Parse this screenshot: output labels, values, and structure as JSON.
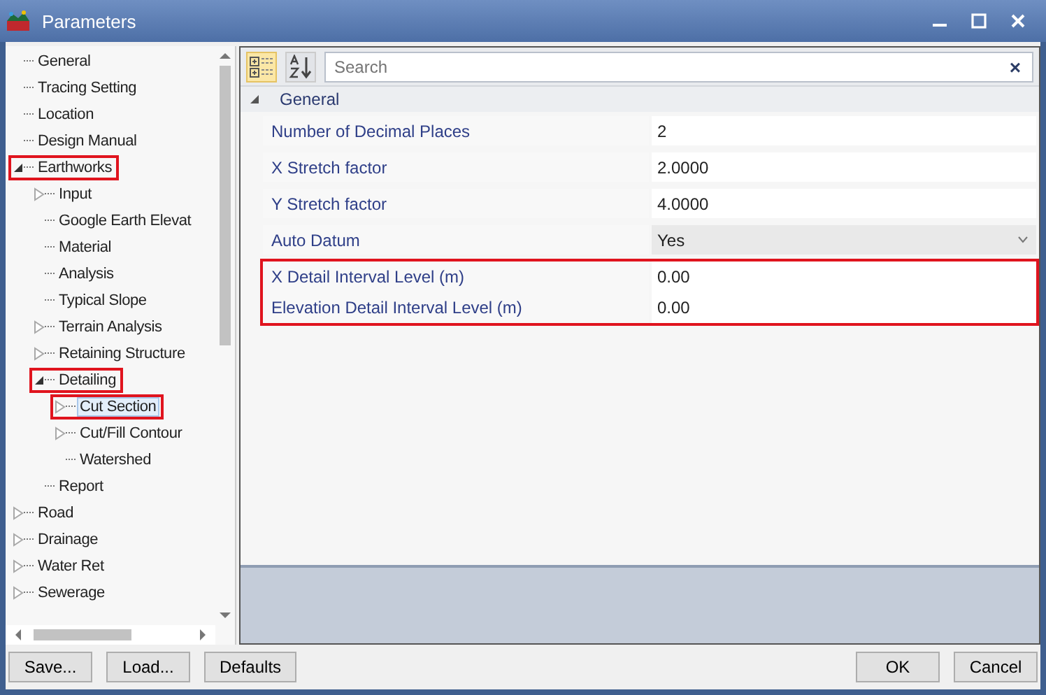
{
  "window": {
    "title": "Parameters"
  },
  "tree": [
    {
      "label": "General",
      "kind": "leaf",
      "selected": false,
      "highlighted": false
    },
    {
      "label": "Tracing Setting",
      "kind": "leaf",
      "selected": false,
      "highlighted": false
    },
    {
      "label": "Location",
      "kind": "leaf",
      "selected": false,
      "highlighted": false
    },
    {
      "label": "Design Manual",
      "kind": "leaf",
      "selected": false,
      "highlighted": false
    },
    {
      "label": "Earthworks",
      "kind": "expanded",
      "selected": false,
      "highlighted": true,
      "children": [
        {
          "label": "Input",
          "kind": "collapsed",
          "selected": false,
          "highlighted": false
        },
        {
          "label": "Google Earth Elevat",
          "kind": "leaf",
          "selected": false,
          "highlighted": false
        },
        {
          "label": "Material",
          "kind": "leaf",
          "selected": false,
          "highlighted": false
        },
        {
          "label": "Analysis",
          "kind": "leaf",
          "selected": false,
          "highlighted": false
        },
        {
          "label": "Typical Slope",
          "kind": "leaf",
          "selected": false,
          "highlighted": false
        },
        {
          "label": "Terrain Analysis",
          "kind": "collapsed",
          "selected": false,
          "highlighted": false
        },
        {
          "label": "Retaining Structure",
          "kind": "collapsed",
          "selected": false,
          "highlighted": false
        },
        {
          "label": "Detailing",
          "kind": "expanded",
          "selected": false,
          "highlighted": true,
          "children": [
            {
              "label": "Cut Section",
              "kind": "collapsed",
              "selected": true,
              "highlighted": true
            },
            {
              "label": "Cut/Fill Contour",
              "kind": "collapsed",
              "selected": false,
              "highlighted": false
            },
            {
              "label": "Watershed",
              "kind": "leaf",
              "selected": false,
              "highlighted": false
            }
          ]
        },
        {
          "label": "Report",
          "kind": "leaf",
          "selected": false,
          "highlighted": false
        }
      ]
    },
    {
      "label": "Road",
      "kind": "collapsed",
      "selected": false,
      "highlighted": false
    },
    {
      "label": "Drainage",
      "kind": "collapsed",
      "selected": false,
      "highlighted": false
    },
    {
      "label": "Water Ret",
      "kind": "collapsed",
      "selected": false,
      "highlighted": false
    },
    {
      "label": "Sewerage",
      "kind": "collapsed",
      "selected": false,
      "highlighted": false
    }
  ],
  "toolbar": {
    "categorized_selected": true,
    "alphabetical_selected": false,
    "search": {
      "placeholder": "Search"
    },
    "clear": "×"
  },
  "group": {
    "label": "General",
    "expanded": true
  },
  "properties": [
    {
      "name": "Number of Decimal Places",
      "value": "2",
      "kind": "text",
      "highlighted": false
    },
    {
      "name": "X Stretch factor",
      "value": "2.0000",
      "kind": "text",
      "highlighted": false
    },
    {
      "name": "Y Stretch factor",
      "value": "4.0000",
      "kind": "text",
      "highlighted": false
    },
    {
      "name": "Auto Datum",
      "value": "Yes",
      "kind": "dropdown",
      "highlighted": false
    },
    {
      "name": "X Detail Interval Level (m)",
      "value": "0.00",
      "kind": "text",
      "highlighted": true
    },
    {
      "name": "Elevation Detail Interval Level (m)",
      "value": "0.00",
      "kind": "text",
      "highlighted": true
    }
  ],
  "buttons": {
    "left": [
      "Save...",
      "Load...",
      "Defaults"
    ],
    "right": [
      "OK",
      "Cancel"
    ]
  }
}
